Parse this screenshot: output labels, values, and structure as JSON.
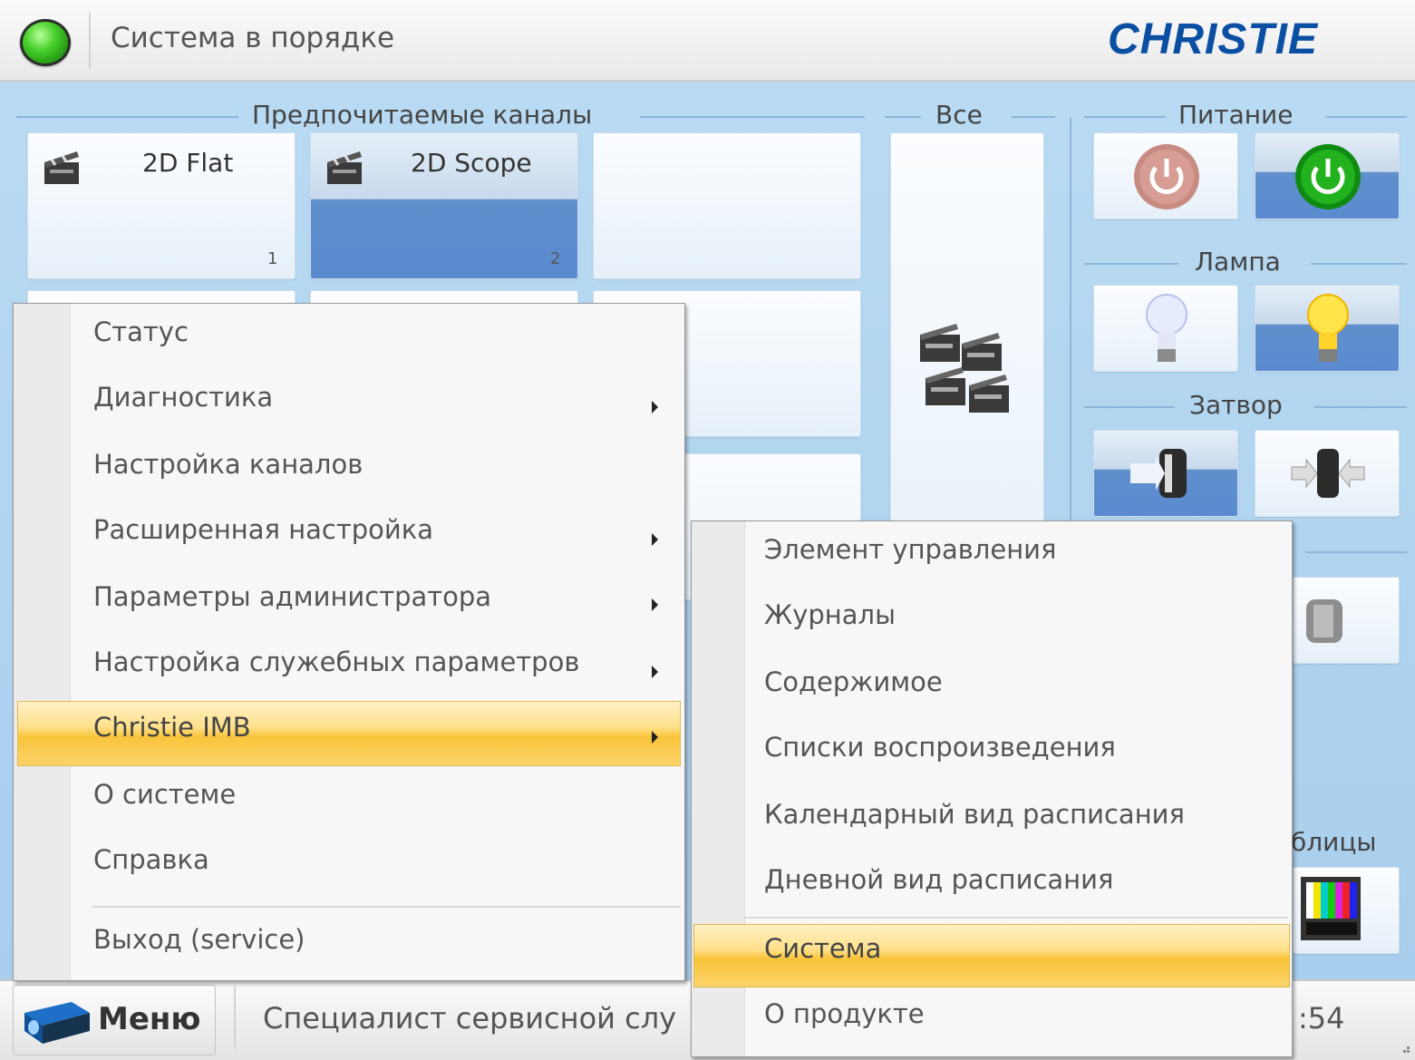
{
  "header": {
    "status_text": "Система в порядке",
    "logo": "CHRISTIE",
    "status_color": "#2eb31b"
  },
  "sections": {
    "preferred_channels": "Предпочитаемые каналы",
    "all": "Все",
    "power": "Питание",
    "lamp": "Лампа",
    "shutter": "Затвор",
    "tables_partial": "блицы"
  },
  "channels": [
    {
      "label": "2D Flat",
      "number": "1",
      "selected": false
    },
    {
      "label": "2D Scope",
      "number": "2",
      "selected": true
    }
  ],
  "main_menu": {
    "items": [
      {
        "label": "Статус",
        "submenu": false
      },
      {
        "label": "Диагностика",
        "submenu": true
      },
      {
        "label": "Настройка каналов",
        "submenu": false
      },
      {
        "label": "Расширенная настройка",
        "submenu": true
      },
      {
        "label": "Параметры администратора",
        "submenu": true
      },
      {
        "label": "Настройка служебных параметров",
        "submenu": true
      },
      {
        "label": "Christie IMB",
        "submenu": true,
        "highlighted": true
      },
      {
        "label": "О системе",
        "submenu": false
      },
      {
        "label": "Справка",
        "submenu": false
      }
    ],
    "exit": "Выход (service)"
  },
  "sub_menu": {
    "items": [
      {
        "label": "Элемент управления"
      },
      {
        "label": "Журналы"
      },
      {
        "label": "Содержимое"
      },
      {
        "label": "Списки воспроизведения"
      },
      {
        "label": "Календарный вид расписания"
      },
      {
        "label": "Дневной вид расписания"
      },
      {
        "label": "Система",
        "highlighted": true
      }
    ],
    "about": "О продукте"
  },
  "bottom": {
    "menu_label": "Меню",
    "user_text": "Специалист сервисной слу",
    "time_partial": ":54"
  },
  "colors": {
    "accent_blue": "#5a8bd0",
    "highlight": "#f9c43a",
    "power_on": "#1fa51a",
    "power_off": "#c88a82"
  }
}
